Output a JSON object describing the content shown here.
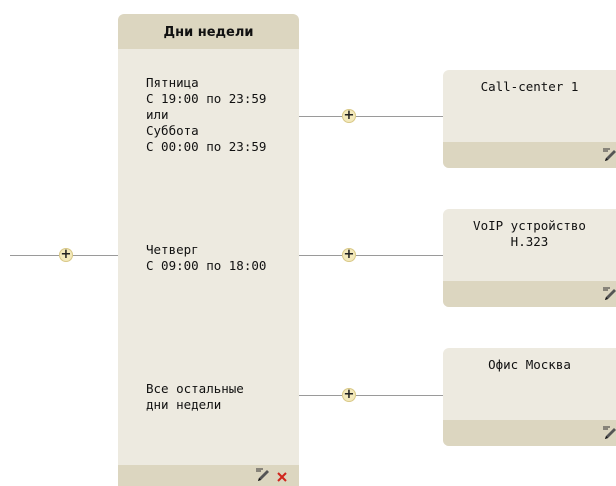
{
  "days_block": {
    "title": "Дни недели",
    "conditions": [
      {
        "text": "Пятница\nС 19:00 по 23:59\nили\nСуббота\nС 00:00 по 23:59"
      },
      {
        "text": "Четверг\nС 09:00 по 18:00"
      },
      {
        "text": "Все остальные\nдни недели"
      }
    ],
    "footer_icons": [
      "edit-icon",
      "delete-icon"
    ]
  },
  "targets": [
    {
      "title": "Call-center 1",
      "icon": "edit-icon"
    },
    {
      "title": "VoIP устройство\nH.323",
      "icon": "edit-icon"
    },
    {
      "title": "Офис Москва",
      "icon": "edit-icon"
    }
  ],
  "connector_symbol": "+",
  "colors": {
    "panel": "#edeae0",
    "header": "#dcd6c0",
    "plus_button": "#f3e9bb",
    "line": "#9a9a9a",
    "delete": "#d0261c"
  }
}
